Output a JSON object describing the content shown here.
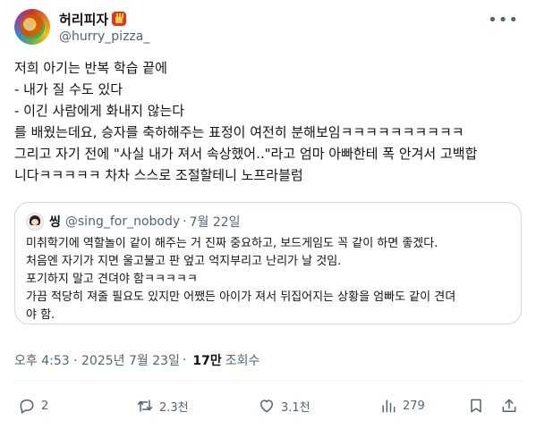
{
  "author": {
    "display_name": "허리피자",
    "handle": "@hurry_pizza_"
  },
  "tweet": {
    "text": "저희 아기는 반복 학습 끝에\n- 내가 질 수도 있다\n- 이긴 사람에게 화내지 않는다\n를 배웠는데요, 승자를 축하해주는 표정이 여전히 분해보임ㅋㅋㅋㅋㅋㅋㅋㅋㅋㅋ\n그리고 자기 전에 \"사실 내가 져서 속상했어..\"라고 엄마 아빠한테 폭 안겨서 고백합\n니다ㅋㅋㅋㅋㅋ 차차 스스로 조절할테니 노프라블럼"
  },
  "quote": {
    "name": "씽",
    "handle": "@sing_for_nobody",
    "separator": "·",
    "date": "7월 22일",
    "text": "미취학기에 역할놀이 같이 해주는 거 진짜 중요하고, 보드게임도 꼭 같이 하면 좋겠다.\n처음엔 자기가 지면 울고불고 판 엎고 억지부리고 난리가 날 것임.\n포기하지 말고 견뎌야 함ㅋㅋㅋㅋㅋ\n가끔 적당히 져줄 필요도 있지만 어쨌든 아이가 져서 뒤집어지는 상황을 엄빠도 같이 견뎌\n야 함."
  },
  "meta": {
    "timestamp": "오후 4:53 · 2025년 7월 23일",
    "separator": "·",
    "views_count": "17만",
    "views_label": "조회수"
  },
  "actions": {
    "replies": "2",
    "retweets": "2.3천",
    "likes": "3.1천",
    "views": "279"
  },
  "icons": {
    "reply": "reply-icon",
    "retweet": "retweet-icon",
    "like": "heart-icon",
    "views": "bar-chart-icon",
    "bookmark": "bookmark-icon",
    "share": "share-icon",
    "more": "more-icon",
    "badge": "fries-badge-icon"
  },
  "colors": {
    "text": "#0f1419",
    "secondary": "#536471",
    "border": "#cfd9de",
    "badge": "#e8341c"
  }
}
